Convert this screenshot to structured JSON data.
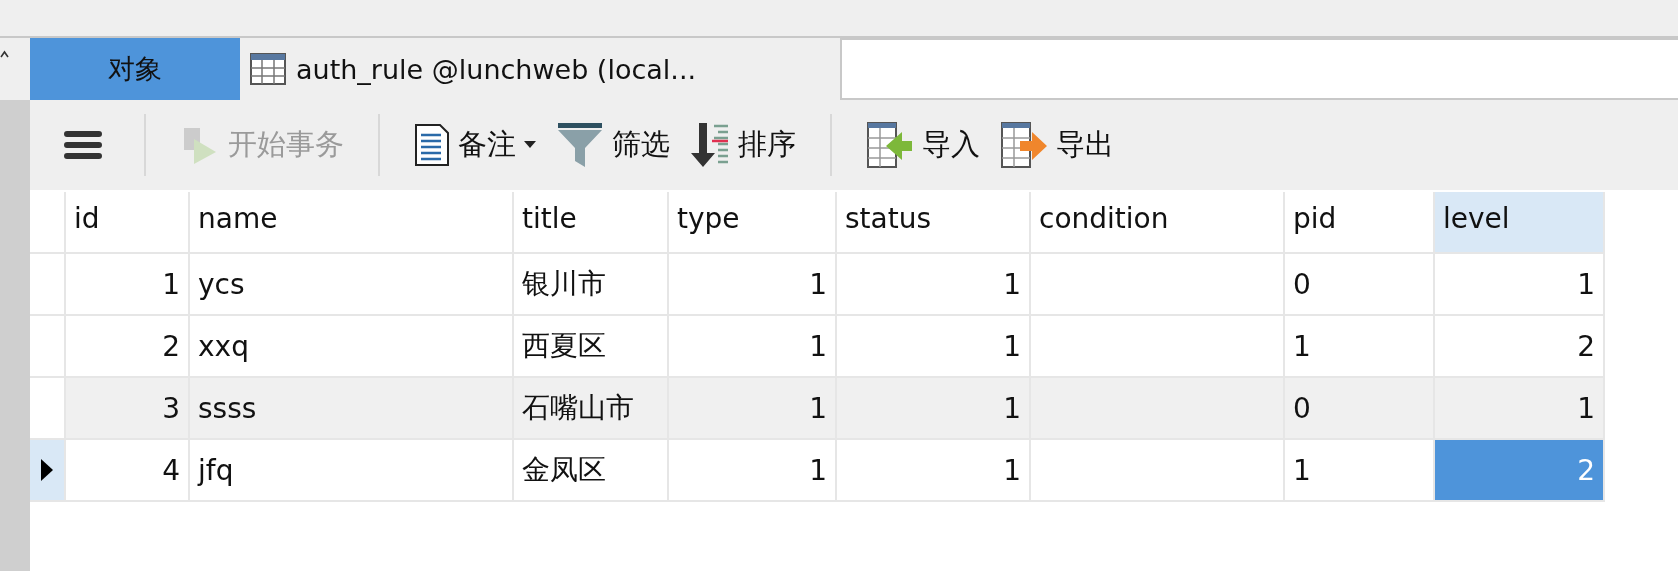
{
  "tabs": [
    {
      "label": "对象",
      "selected": true
    },
    {
      "label": "auth_rule @lunchweb (local...",
      "selected": false
    }
  ],
  "toolbar": [
    {
      "kind": "menu"
    },
    {
      "kind": "divider"
    },
    {
      "kind": "begin",
      "label": "开始事务",
      "disabled": true
    },
    {
      "kind": "divider"
    },
    {
      "kind": "note",
      "label": "备注",
      "disabled": false,
      "dropdown": true
    },
    {
      "kind": "filter",
      "label": "筛选",
      "disabled": false
    },
    {
      "kind": "sort",
      "label": "排序",
      "disabled": false
    },
    {
      "kind": "divider"
    },
    {
      "kind": "import",
      "label": "导入",
      "disabled": false
    },
    {
      "kind": "export",
      "label": "导出",
      "disabled": false
    }
  ],
  "table": {
    "columns": [
      {
        "label": "id",
        "selected": false
      },
      {
        "label": "name",
        "selected": false
      },
      {
        "label": "title",
        "selected": false
      },
      {
        "label": "type",
        "selected": false
      },
      {
        "label": "status",
        "selected": false
      },
      {
        "label": "condition",
        "selected": false
      },
      {
        "label": "pid",
        "selected": false
      },
      {
        "label": "level",
        "selected": true
      }
    ],
    "rows": [
      {
        "selected": false,
        "shaded": false,
        "cells": [
          {
            "text": "1",
            "selected": false
          },
          {
            "text": "ycs",
            "selected": false
          },
          {
            "text": "银川市",
            "selected": false
          },
          {
            "text": "1",
            "selected": false
          },
          {
            "text": "1",
            "selected": false
          },
          {
            "text": "",
            "selected": false
          },
          {
            "text": "0",
            "selected": false
          },
          {
            "text": "1",
            "selected": false
          }
        ]
      },
      {
        "selected": false,
        "shaded": false,
        "cells": [
          {
            "text": "2",
            "selected": false
          },
          {
            "text": "xxq",
            "selected": false
          },
          {
            "text": "西夏区",
            "selected": false
          },
          {
            "text": "1",
            "selected": false
          },
          {
            "text": "1",
            "selected": false
          },
          {
            "text": "",
            "selected": false
          },
          {
            "text": "1",
            "selected": false
          },
          {
            "text": "2",
            "selected": false
          }
        ]
      },
      {
        "selected": false,
        "shaded": true,
        "cells": [
          {
            "text": "3",
            "selected": false
          },
          {
            "text": "ssss",
            "selected": false
          },
          {
            "text": "石嘴山市",
            "selected": false
          },
          {
            "text": "1",
            "selected": false
          },
          {
            "text": "1",
            "selected": false
          },
          {
            "text": "",
            "selected": false
          },
          {
            "text": "0",
            "selected": false
          },
          {
            "text": "1",
            "selected": false
          }
        ]
      },
      {
        "selected": true,
        "shaded": false,
        "cells": [
          {
            "text": "4",
            "selected": false
          },
          {
            "text": "jfq",
            "selected": false
          },
          {
            "text": "金凤区",
            "selected": false
          },
          {
            "text": "1",
            "selected": false
          },
          {
            "text": "1",
            "selected": false
          },
          {
            "text": "",
            "selected": false
          },
          {
            "text": "1",
            "selected": false
          },
          {
            "text": "2",
            "selected": true
          }
        ]
      }
    ]
  }
}
